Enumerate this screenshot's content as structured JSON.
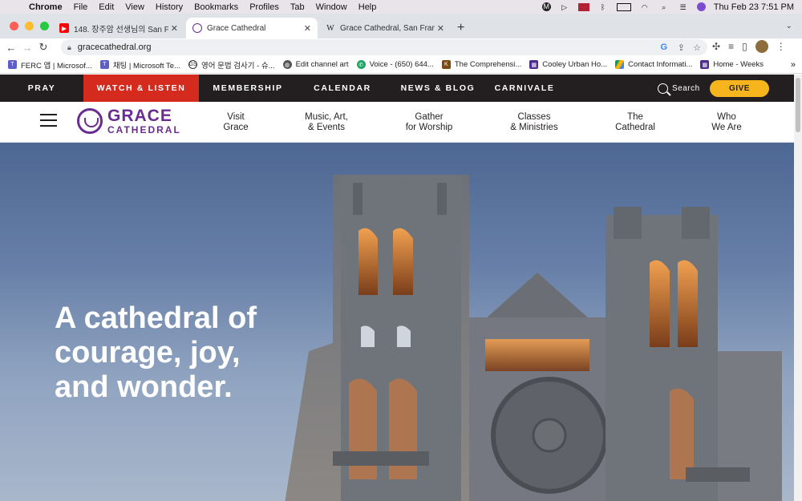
{
  "macos_menu": {
    "app": "Chrome",
    "items": [
      "File",
      "Edit",
      "View",
      "History",
      "Bookmarks",
      "Profiles",
      "Tab",
      "Window",
      "Help"
    ],
    "datetime": "Thu Feb 23  7:51 PM"
  },
  "tabs": [
    {
      "title": "148. 장주암 선생님의 San Francis",
      "icon": "youtube-icon",
      "active": false
    },
    {
      "title": "Grace Cathedral",
      "icon": "grace-favicon",
      "active": true
    },
    {
      "title": "Grace Cathedral, San Francisc",
      "icon": "wikipedia-icon",
      "active": false
    }
  ],
  "address": {
    "url": "gracecathedral.org"
  },
  "bookmarks": [
    {
      "label": "FERC 앱 | Microsof...",
      "color": "#5b5fc7"
    },
    {
      "label": "채팅 | Microsoft Te...",
      "color": "#5b5fc7"
    },
    {
      "label": "영어 문법 검사기 - 슈...",
      "color": "#333333"
    },
    {
      "label": "Edit channel art",
      "color": "#444444"
    },
    {
      "label": "Voice - (650) 644...",
      "color": "#1ea362"
    },
    {
      "label": "The Comprehensi...",
      "color": "#7a4a10"
    },
    {
      "label": "Cooley Urban Ho...",
      "color": "#4b2e8f"
    },
    {
      "label": "Contact Informati...",
      "color": "#1a73e8"
    },
    {
      "label": "Home - Weeks",
      "color": "#4b2e8f"
    }
  ],
  "site": {
    "top_nav": [
      {
        "label": "PRAY"
      },
      {
        "label": "WATCH & LISTEN"
      },
      {
        "label": "MEMBERSHIP"
      },
      {
        "label": "CALENDAR"
      },
      {
        "label": "NEWS & BLOG"
      },
      {
        "label": "CARNIVALE"
      }
    ],
    "search_label": "Search",
    "give_label": "GIVE",
    "logo": {
      "line1": "GRACE",
      "line2": "CATHEDRAL"
    },
    "main_nav": [
      {
        "line1": "Visit",
        "line2": "Grace"
      },
      {
        "line1": "Music, Art,",
        "line2": "& Events"
      },
      {
        "line1": "Gather",
        "line2": "for Worship"
      },
      {
        "line1": "Classes",
        "line2": "& Ministries"
      },
      {
        "line1": "The",
        "line2": "Cathedral"
      },
      {
        "line1": "Who",
        "line2": "We Are"
      }
    ],
    "hero_heading": "A cathedral of courage, joy, and wonder.",
    "colors": {
      "nav_bg": "#231f20",
      "watch_red": "#d52b1e",
      "give_gold": "#f6b51c",
      "brand_purple": "#6a2c91"
    }
  }
}
